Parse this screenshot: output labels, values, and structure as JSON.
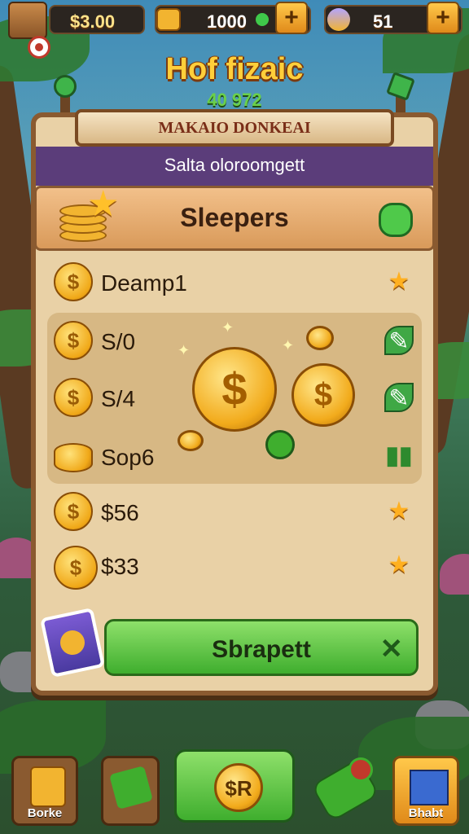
{
  "hud": {
    "currency_1": "$3.00",
    "currency_2": "1000",
    "currency_3": "51",
    "plus_label": "+"
  },
  "title": "Hof fizaic",
  "subtitle": "40 972",
  "banner": "MAKAIO DONKEAI",
  "tagline": "Salta oloroomgett",
  "section": {
    "label": "Sleepers"
  },
  "rows": [
    {
      "label": "Deamp1",
      "icon": "star-icon"
    },
    {
      "label": "S/0",
      "icon": "leaf-icon"
    },
    {
      "label": "S/4",
      "icon": "leaf-icon"
    },
    {
      "label": "Sop6",
      "icon": "bars-icon"
    },
    {
      "label": "$56",
      "icon": "star-icon"
    },
    {
      "label": "$33",
      "icon": "star-icon"
    }
  ],
  "coin_symbol": "$",
  "cta": {
    "label": "Sbrapett",
    "close": "✕"
  },
  "nav": {
    "left_label": "Borke",
    "center_label": "$R",
    "right_label": "Bhabt"
  },
  "colors": {
    "accent_green": "#3fae2e",
    "gold": "#f2ab1c",
    "panel": "#e9d1a6",
    "wood": "#8a5a30",
    "purple": "#5b3d7a"
  }
}
